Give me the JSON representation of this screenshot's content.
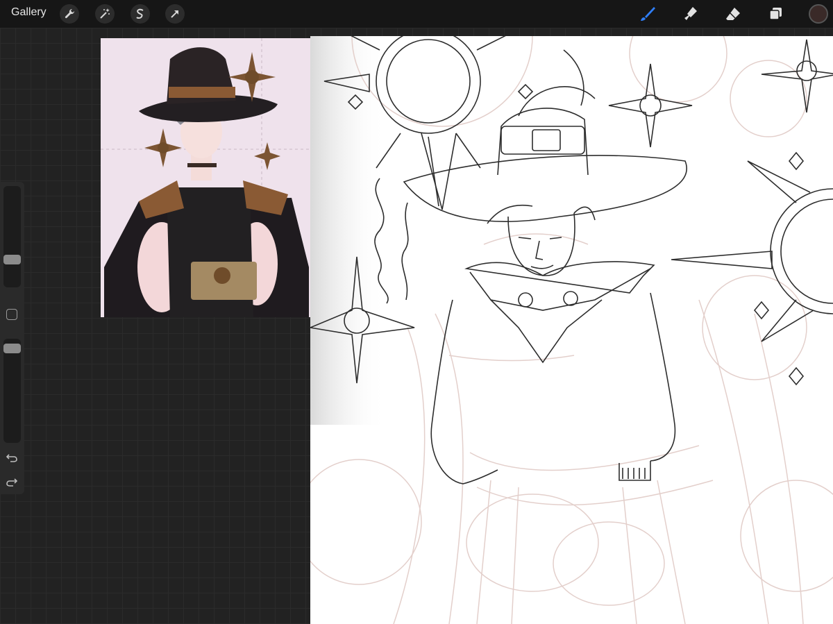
{
  "toolbar": {
    "gallery_label": "Gallery",
    "left_tools": [
      "wrench-icon",
      "magic-wand-icon",
      "selection-icon",
      "transform-arrow-icon"
    ],
    "right_tools": [
      "brush-icon",
      "smudge-icon",
      "eraser-icon",
      "layers-icon"
    ],
    "active_tool": "brush-icon",
    "accent_color": "#2f7ef5",
    "current_color": "#3a2a28"
  },
  "sidebar": {
    "brush_size_level": 0.25,
    "opacity_level": 0.95
  },
  "colors": {
    "workspace": "#222222",
    "toolbar": "#161616",
    "sketch_line": "#2d2d2d",
    "sketch_rough": "#e3cfcb"
  }
}
